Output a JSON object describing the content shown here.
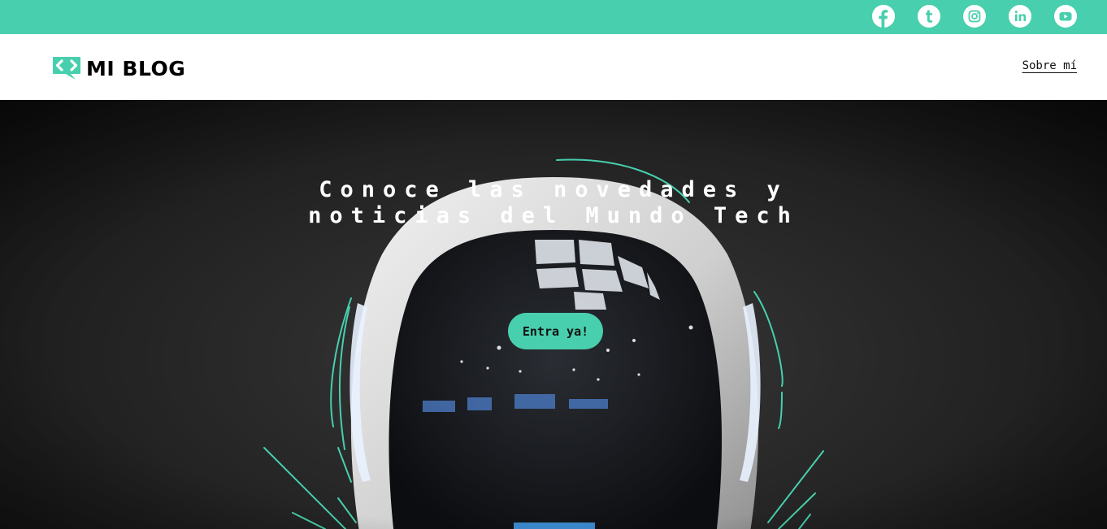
{
  "colors": {
    "accent": "#48cfad",
    "hero_background": "#1e1e1e",
    "text_light": "#ffffff",
    "text_dark": "#111111"
  },
  "social": [
    {
      "name": "facebook-icon"
    },
    {
      "name": "tumblr-icon"
    },
    {
      "name": "instagram-icon"
    },
    {
      "name": "linkedin-icon"
    },
    {
      "name": "youtube-icon"
    }
  ],
  "header": {
    "logo_text": "MI BLOG",
    "logo_icon": "code-chat-bubble-icon",
    "nav_link": "Sobre mí"
  },
  "hero": {
    "title_line1": "Conoce las novedades y",
    "title_line2": "noticias del Mundo Tech",
    "cta_label": "Entra ya!",
    "image": "astronaut-helmet-photo"
  }
}
